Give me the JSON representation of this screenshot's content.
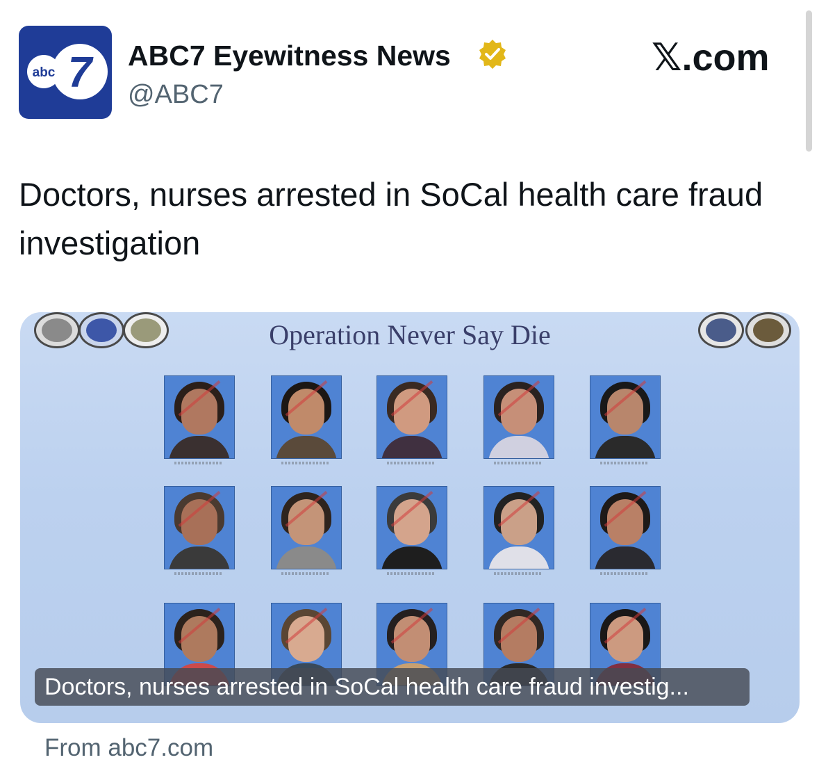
{
  "author": {
    "display_name": "ABC7 Eyewitness News",
    "handle": "@ABC7",
    "avatar_text": "abc",
    "avatar_numeral": "7",
    "verified_icon": "gold-verified-badge"
  },
  "brand": {
    "label": "𝕏.com"
  },
  "tweet": {
    "text": "Doctors, nurses arrested in SoCal health care fraud investigation"
  },
  "card": {
    "slide_title": "Operation Never Say Die",
    "caption": "Doctors, nurses arrested in SoCal health care fraud investig...",
    "source": "From abc7.com"
  },
  "colors": {
    "avatar_bg": "#1f3c97",
    "verified_gold": "#e2b719",
    "card_bg": "#c3d6f1",
    "photo_bg": "#4f83d3"
  }
}
